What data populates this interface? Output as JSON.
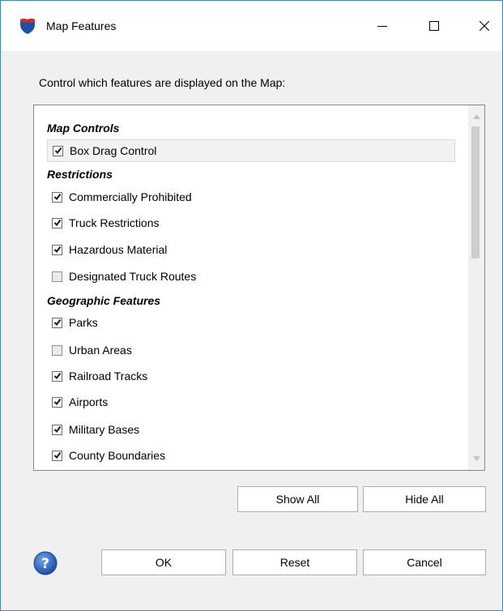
{
  "window": {
    "title": "Map Features",
    "app_icon": "interstate-shield-icon",
    "accent_color": "#3a87c7",
    "controls": [
      "minimize",
      "maximize",
      "close"
    ]
  },
  "prompt": "Control which features are displayed on the Map:",
  "groups": [
    {
      "header": "Map Controls",
      "items": [
        {
          "label": "Box Drag Control",
          "checked": true,
          "selected": true
        }
      ]
    },
    {
      "header": "Restrictions",
      "items": [
        {
          "label": "Commercially Prohibited",
          "checked": true
        },
        {
          "label": "Truck Restrictions",
          "checked": true
        },
        {
          "label": "Hazardous Material",
          "checked": true
        },
        {
          "label": "Designated Truck Routes",
          "checked": false
        }
      ]
    },
    {
      "header": "Geographic Features",
      "items": [
        {
          "label": "Parks",
          "checked": true
        },
        {
          "label": "Urban Areas",
          "checked": false
        },
        {
          "label": "Railroad Tracks",
          "checked": true
        },
        {
          "label": "Airports",
          "checked": true
        },
        {
          "label": "Military Bases",
          "checked": true
        },
        {
          "label": "County Boundaries",
          "checked": true
        }
      ]
    }
  ],
  "buttons": {
    "show_all": "Show All",
    "hide_all": "Hide All",
    "ok": "OK",
    "reset": "Reset",
    "cancel": "Cancel"
  },
  "icons": {
    "help": "help-question-icon"
  }
}
